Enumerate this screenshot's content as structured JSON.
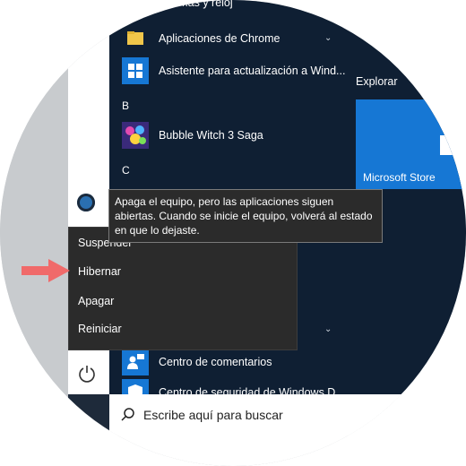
{
  "app_list": {
    "top_partial": "Alarmas y reloj",
    "items_a": [
      {
        "label": "Aplicaciones de Chrome",
        "icon": "folder-icon"
      },
      {
        "label": "Asistente para actualización a Wind...",
        "icon": "windows-logo-icon"
      }
    ],
    "letter_b": "B",
    "items_b": [
      {
        "label": "Bubble Witch 3 Saga",
        "icon": "bubble-witch-icon"
      }
    ],
    "letter_c": "C",
    "items_c": [
      {
        "label": "Centro de comentarios",
        "icon": "feedback-hub-icon"
      },
      {
        "label": "Centro de seguridad de Windows D",
        "icon": "shield-icon"
      }
    ]
  },
  "tiles": {
    "section_title": "Explorar",
    "store_label": "Microsoft Store"
  },
  "power_menu": {
    "items": [
      "Suspender",
      "Hibernar",
      "Apagar",
      "Reiniciar"
    ]
  },
  "tooltip": {
    "text": "Apaga el equipo, pero las aplicaciones siguen abiertas. Cuando se inicie el equipo, volverá al estado en que lo dejaste."
  },
  "search": {
    "placeholder": "Escribe aquí para buscar"
  },
  "colors": {
    "menu_bg": "#0f1f33",
    "accent": "#1677d4",
    "arrow": "#f06a6a"
  }
}
